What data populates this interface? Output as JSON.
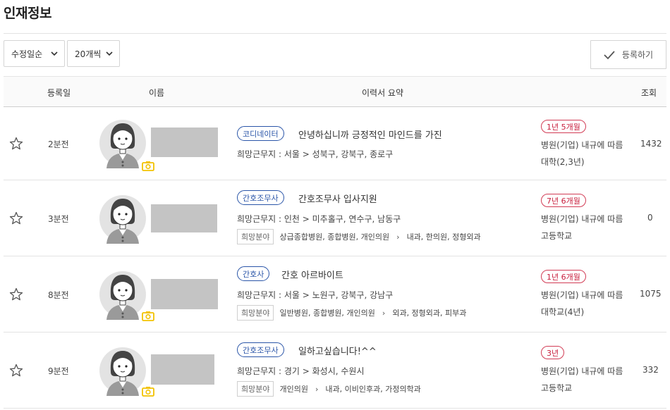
{
  "page": {
    "title": "인재정보"
  },
  "toolbar": {
    "sort_select": "수정일순",
    "count_select": "20개씩",
    "register_label": "등록하기"
  },
  "table": {
    "headers": {
      "date": "등록일",
      "name": "이름",
      "summary": "이력서 요약",
      "views": "조회"
    }
  },
  "rows": [
    {
      "registered": "2분전",
      "tag": "코디네이터",
      "headline": "안녕하십니까 긍정적인 마인드를 가진",
      "location": "희망근무지 : 서울 > 성북구, 강북구, 종로구",
      "career": "1년 5개월",
      "salary": "병원(기업) 내규에 따름",
      "education": "대학(2,3년)",
      "views": "1432"
    },
    {
      "registered": "3분전",
      "tag": "간호조무사",
      "headline": "간호조무사 입사지원",
      "location": "희망근무지 : 인천 > 미추홀구, 연수구, 남동구",
      "field_label": "희망분야",
      "field_types": "상급종합병원, 종합병원, 개인의원",
      "field_departments": "내과, 한의원, 정형외과",
      "career": "7년 6개월",
      "salary": "병원(기업) 내규에 따름",
      "education": "고등학교",
      "views": "0"
    },
    {
      "registered": "8분전",
      "tag": "간호사",
      "headline": "간호 아르바이트",
      "location": "희망근무지 : 서울 > 노원구, 강북구, 강남구",
      "field_label": "희망분야",
      "field_types": "일반병원, 종합병원, 개인의원",
      "field_departments": "외과, 정형외과, 피부과",
      "career": "1년 6개월",
      "salary": "병원(기업) 내규에 따름",
      "education": "대학교(4년)",
      "views": "1075"
    },
    {
      "registered": "9분전",
      "tag": "간호조무사",
      "headline": "일하고싶습니다!^^",
      "location": "희망근무지 : 경기 > 화성시, 수원시",
      "field_label": "희망분야",
      "field_types": "개인의원",
      "field_departments": "내과, 이비인후과, 가정의학과",
      "career": "3년",
      "salary": "병원(기업) 내규에 따름",
      "education": "고등학교",
      "views": "332"
    }
  ],
  "colors": {
    "tag": "#2a55a8",
    "career": "#c8203e",
    "camera": "#f2c200",
    "placeholder": "#c4c4c4"
  },
  "icons": {
    "star": "star-icon",
    "camera": "camera-icon",
    "check": "check-icon",
    "chevron": "chevron-down-icon"
  }
}
